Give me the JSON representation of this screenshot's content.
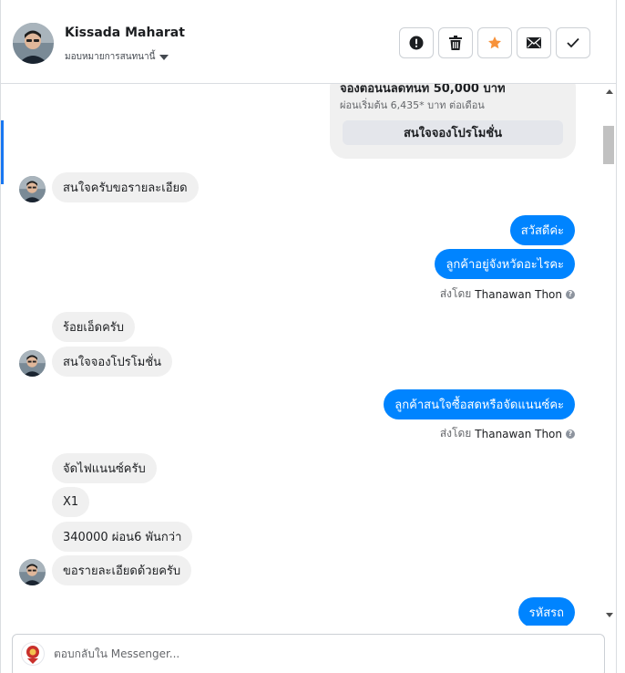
{
  "header": {
    "contact_name": "Kissada Maharat",
    "assign_label": "มอบหมายการสนทนานี้",
    "actions": [
      {
        "icon": "exclamation-icon"
      },
      {
        "icon": "trash-icon"
      },
      {
        "icon": "star-icon",
        "color": "#f7923a"
      },
      {
        "icon": "envelope-icon"
      },
      {
        "icon": "check-icon"
      }
    ]
  },
  "promo_card": {
    "title": "จองตอนนลดทนท 50,000 บาท",
    "subtitle": "ผ่อนเริ่มต้น 6,435* บาท ต่อเดือน",
    "button_label": "สนใจจองโปรโมชั่น"
  },
  "messages": [
    {
      "from": "customer",
      "text": "สนใจครับขอรายละเอียด"
    },
    {
      "from": "page",
      "text": "สวัสดีค่ะ"
    },
    {
      "from": "page",
      "text": "ลูกค้าอยู่จังหวัดอะไรคะ"
    },
    {
      "from": "customer",
      "text": "ร้อยเอ็ดครับ"
    },
    {
      "from": "customer",
      "text": "สนใจจองโปรโมชั่น"
    },
    {
      "from": "page",
      "text": "ลูกค้าสนใจซื้อสดหรือจัดแนนซ์คะ"
    },
    {
      "from": "customer",
      "text": "จัดไฟแนนซ์ครับ"
    },
    {
      "from": "customer",
      "text": "X1"
    },
    {
      "from": "customer",
      "text": "340000 ผ่อน6 พันกว่า"
    },
    {
      "from": "customer",
      "text": "ขอรายละเอียดด้วยครับ"
    },
    {
      "from": "page",
      "text": "รหัสรถ"
    }
  ],
  "sent_by": {
    "prefix": "ส่งโดย",
    "agent": "Thanawan Thon",
    "help_glyph": "?"
  },
  "reply": {
    "placeholder": "ตอบกลับใน Messenger..."
  },
  "colors": {
    "outgoing_bubble": "#0084ff",
    "incoming_bubble": "#f0f0f0",
    "accent": "#1877f2"
  }
}
